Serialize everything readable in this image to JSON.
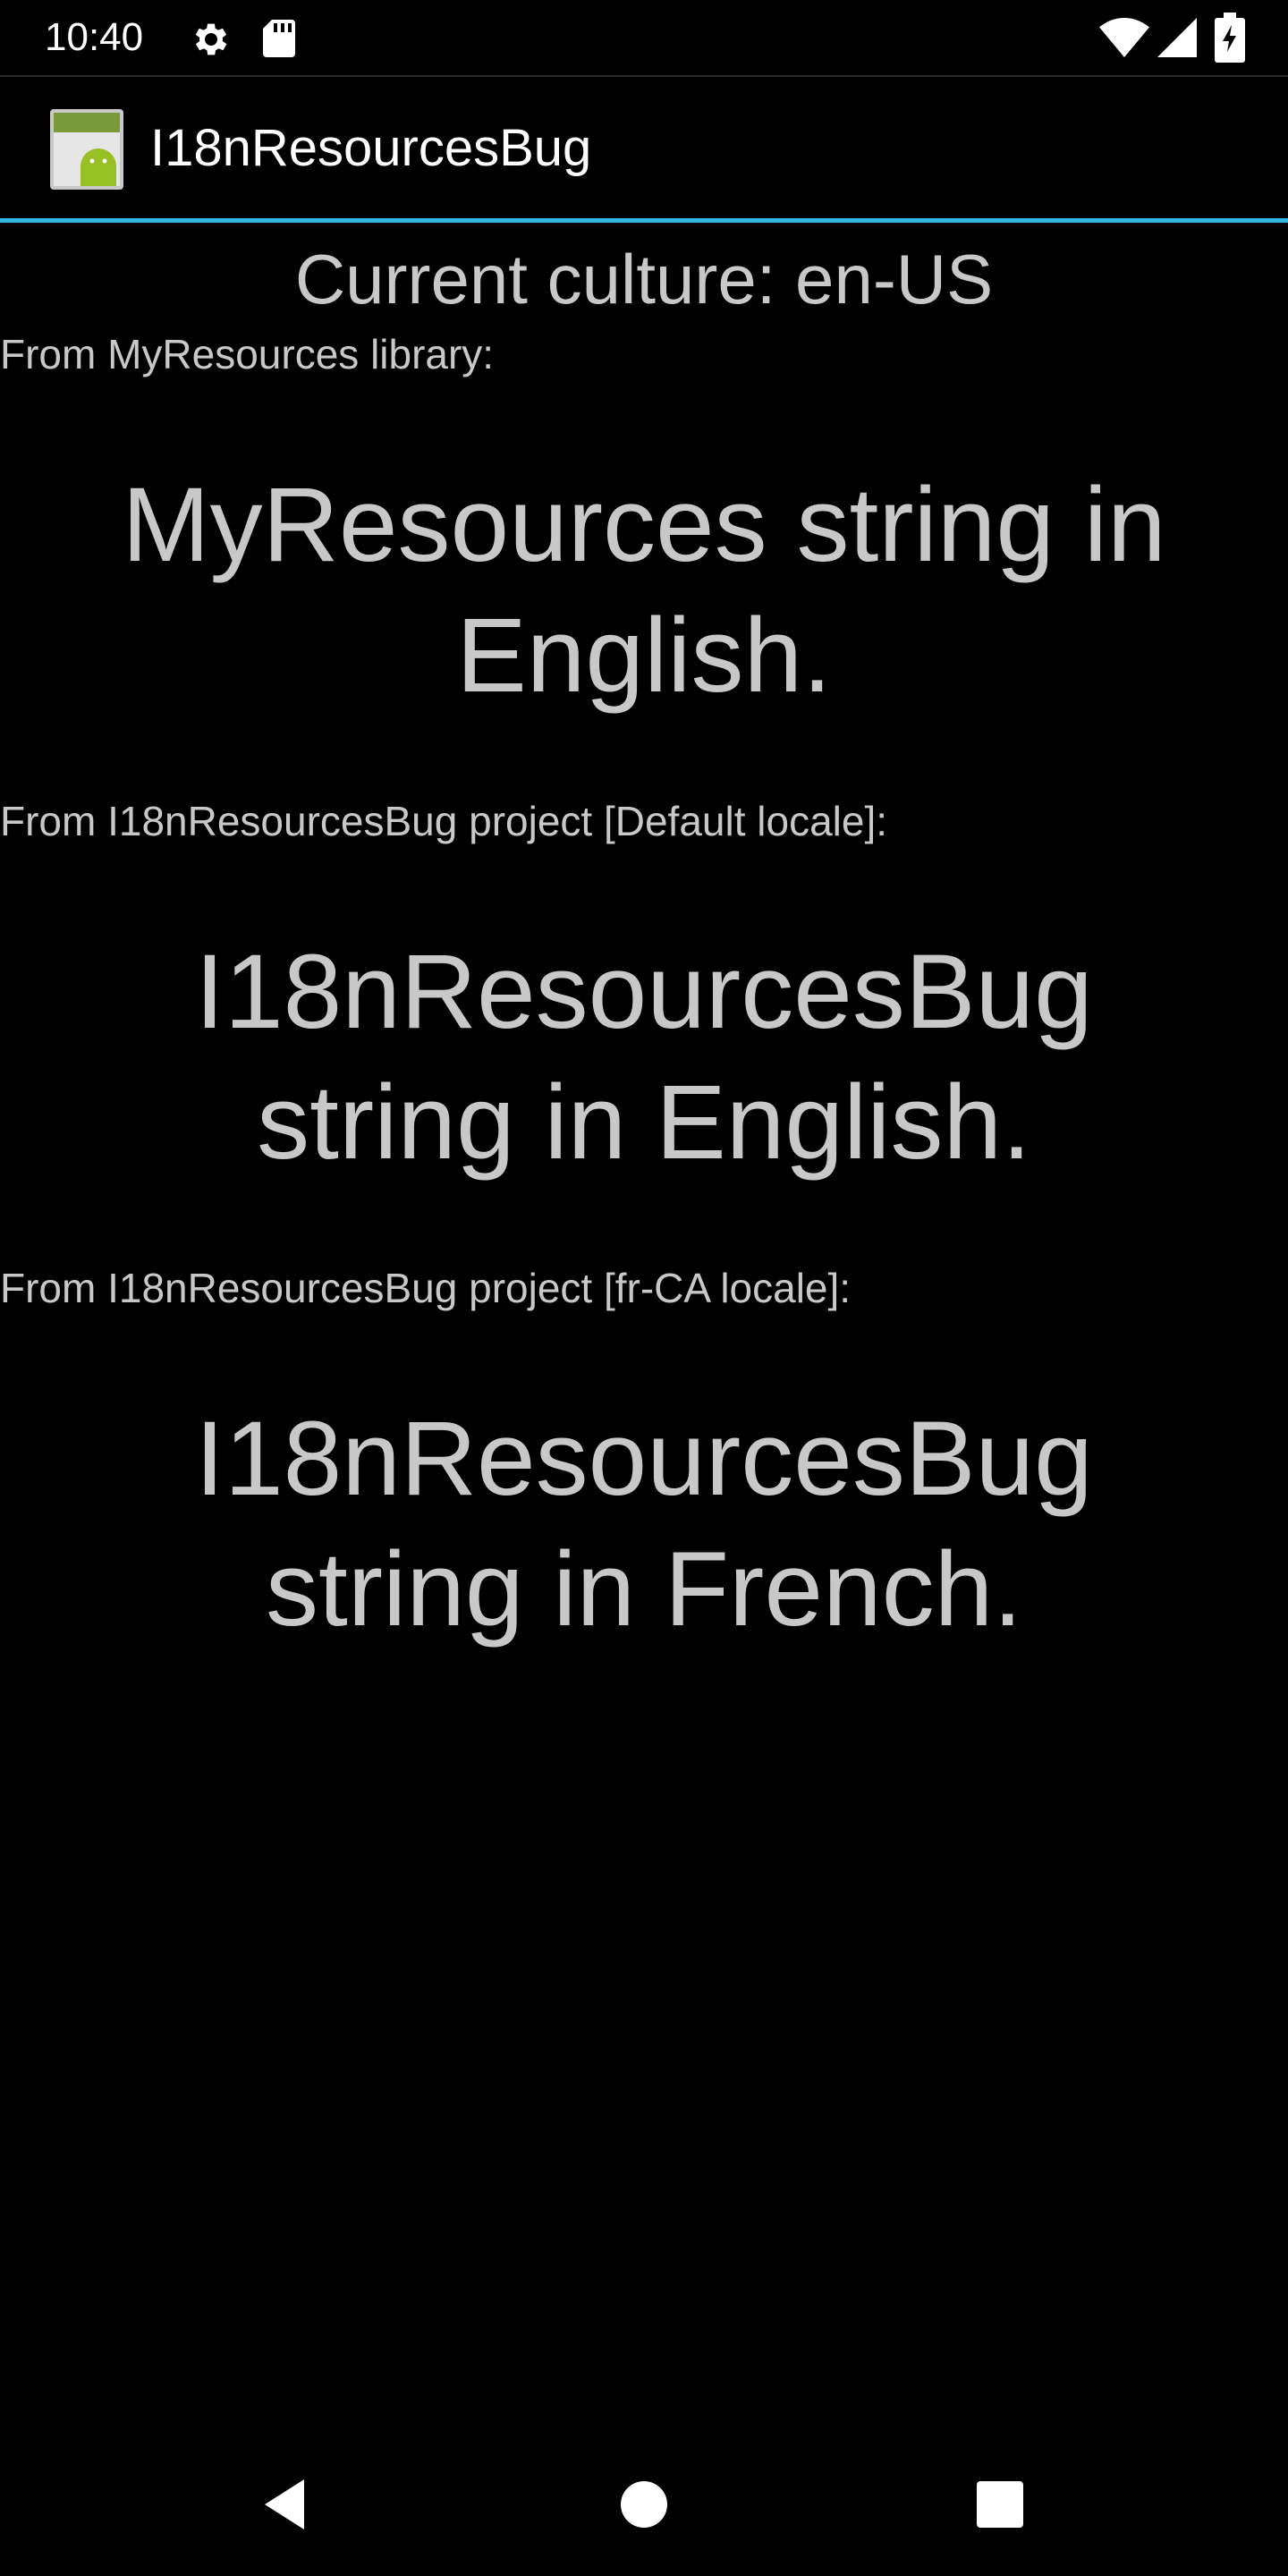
{
  "status_bar": {
    "time": "10:40",
    "icons": [
      "settings-icon",
      "sd-card-icon",
      "wifi-icon",
      "cell-signal-icon",
      "battery-charging-icon"
    ]
  },
  "action_bar": {
    "app_icon": "android-app-icon",
    "title": "I18nResourcesBug",
    "accent_color": "#33b5e5"
  },
  "content": {
    "culture_text": "Current culture: en-US",
    "sections": [
      {
        "label": "From MyResources library:",
        "text": "MyResources string in English."
      },
      {
        "label": "From I18nResourcesBug project [Default locale]:",
        "text": "I18nResourcesBug string in English."
      },
      {
        "label": "From I18nResourcesBug project [fr-CA locale]:",
        "text": "I18nResourcesBug string in French."
      }
    ]
  },
  "nav_bar": {
    "buttons": [
      "back-icon",
      "home-icon",
      "recents-icon"
    ]
  }
}
